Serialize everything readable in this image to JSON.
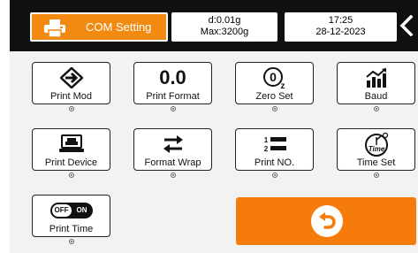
{
  "header": {
    "title": "COM Setting",
    "weight": {
      "division": "d:0.01g",
      "max": "Max:3200g"
    },
    "clock": {
      "time": "17:25",
      "date": "28-12-2023"
    }
  },
  "tiles": [
    {
      "label": "Print Mod",
      "icon": "print-mode-icon"
    },
    {
      "label": "Print Format",
      "icon": "print-format-icon",
      "icon_text": "0.0"
    },
    {
      "label": "Zero Set",
      "icon": "zero-set-icon"
    },
    {
      "label": "Baud",
      "icon": "baud-icon"
    },
    {
      "label": "Print Device",
      "icon": "print-device-icon"
    },
    {
      "label": "Format Wrap",
      "icon": "format-wrap-icon"
    },
    {
      "label": "Print  NO.",
      "icon": "print-number-icon"
    },
    {
      "label": "Time Set",
      "icon": "time-set-icon",
      "icon_text": "Time"
    },
    {
      "label": "Print Time",
      "icon": "print-time-toggle-icon",
      "toggle": {
        "off": "OFF",
        "on": "ON"
      }
    }
  ],
  "colors": {
    "accent": "#f28a12",
    "back_button": "#f57b0a",
    "header_bg": "#101010"
  }
}
